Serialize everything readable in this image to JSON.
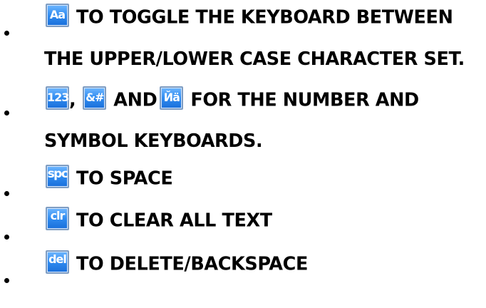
{
  "items": [
    {
      "key": "Aa",
      "line1": "TO TOGGLE THE KEYBOARD BETWEEN",
      "line2": "THE UPPER/LOWER CASE CHARACTER SET."
    },
    {
      "keys": [
        "123",
        "&#",
        "Йä"
      ],
      "comma": ",",
      "and": "AND",
      "line1_rest": "FOR THE NUMBER AND",
      "line2": "SYMBOL KEYBOARDS."
    },
    {
      "key": "spc",
      "line1": "TO SPACE"
    },
    {
      "key": "clr",
      "line1": "TO CLEAR ALL TEXT"
    },
    {
      "key": "del",
      "line1": "TO DELETE/BACKSPACE"
    }
  ],
  "colors": {
    "key_top": "#6fb6ff",
    "key_bottom": "#1a6fda",
    "key_border": "#7f9dc2",
    "text": "#000000"
  },
  "icons": [
    "aa-key-icon",
    "number-key-icon",
    "symbol-key-icon",
    "accent-key-icon",
    "space-key-icon",
    "clear-key-icon",
    "delete-key-icon"
  ]
}
